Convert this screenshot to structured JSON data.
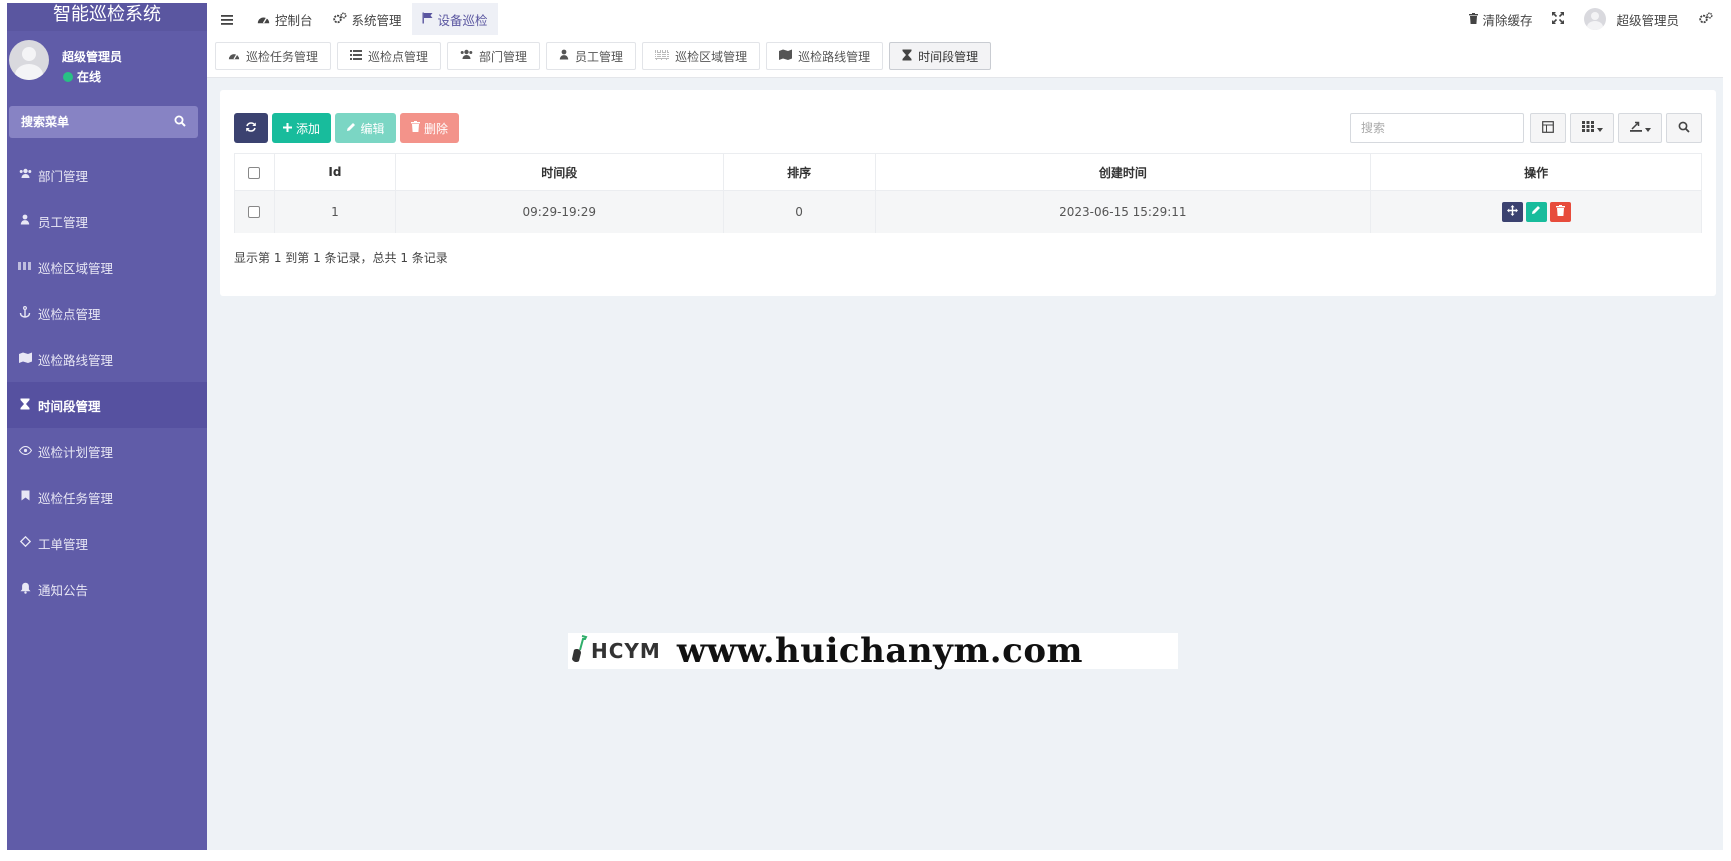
{
  "app": {
    "brand": "智能巡检系统"
  },
  "user": {
    "name": "超级管理员",
    "status": "在线"
  },
  "sidebar": {
    "search_placeholder": "搜索菜单",
    "items": [
      {
        "label": "部门管理",
        "icon": "users-icon"
      },
      {
        "label": "员工管理",
        "icon": "user-icon"
      },
      {
        "label": "巡检区域管理",
        "icon": "area-icon"
      },
      {
        "label": "巡检点管理",
        "icon": "anchor-icon"
      },
      {
        "label": "巡检路线管理",
        "icon": "map-icon"
      },
      {
        "label": "时间段管理",
        "icon": "hourglass-icon",
        "active": true
      },
      {
        "label": "巡检计划管理",
        "icon": "eye-icon"
      },
      {
        "label": "巡检任务管理",
        "icon": "bookmark-icon"
      },
      {
        "label": "工单管理",
        "icon": "diamond-icon"
      },
      {
        "label": "通知公告",
        "icon": "bell-icon"
      }
    ]
  },
  "topnav": {
    "items": [
      {
        "label": "控制台",
        "icon": "dashboard-icon"
      },
      {
        "label": "系统管理",
        "icon": "cogs-icon"
      },
      {
        "label": "设备巡检",
        "icon": "flag-icon",
        "active": true
      }
    ],
    "right": {
      "clear_cache": "清除缓存",
      "user_name": "超级管理员"
    }
  },
  "tabs": [
    {
      "label": "巡检任务管理",
      "icon": "dashboard-icon"
    },
    {
      "label": "巡检点管理",
      "icon": "list-icon"
    },
    {
      "label": "部门管理",
      "icon": "users-icon"
    },
    {
      "label": "员工管理",
      "icon": "user-icon"
    },
    {
      "label": "巡检区域管理",
      "icon": "area-icon"
    },
    {
      "label": "巡检路线管理",
      "icon": "map-icon"
    },
    {
      "label": "时间段管理",
      "icon": "hourglass-icon",
      "active": true
    }
  ],
  "toolbar": {
    "add_label": "添加",
    "edit_label": "编辑",
    "delete_label": "删除",
    "search_placeholder": "搜索"
  },
  "table": {
    "columns": [
      "Id",
      "时间段",
      "排序",
      "创建时间",
      "操作"
    ],
    "rows": [
      {
        "id": "1",
        "period": "09:29-19:29",
        "sort": "0",
        "created": "2023-06-15 15:29:11"
      }
    ]
  },
  "pager": {
    "summary": "显示第 1 到第 1 条记录，总共 1 条记录"
  },
  "watermark": {
    "logo_text": "HCYM",
    "url": "www.huichanym.com"
  },
  "colors": {
    "sidebar_bg": "#605ca8",
    "primary_dark": "#3b4270",
    "success": "#18bc9c",
    "danger": "#e74c3c",
    "page_bg": "#eef2f6"
  }
}
